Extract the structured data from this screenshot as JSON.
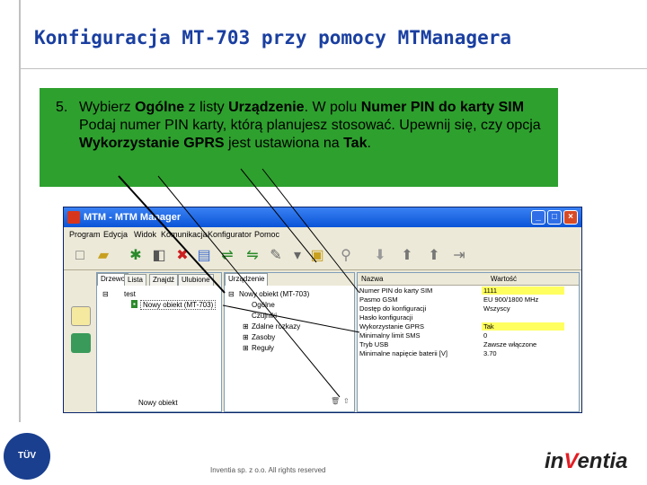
{
  "slide": {
    "title": "Konfiguracja MT-703 przy pomocy MTManagera"
  },
  "callout": {
    "number": "5.",
    "t1": "Wybierz ",
    "b1": "Ogólne",
    "t2": " z listy ",
    "b2": "Urządzenie",
    "t3": ". W polu ",
    "b3": "Numer PIN do karty SIM",
    "t4": " Podaj numer PIN karty, którą planujesz stosować. Upewnij się, czy opcja ",
    "b4": "Wykorzystanie GPRS",
    "t5": " jest ustawiona na ",
    "b5": "Tak",
    "t6": "."
  },
  "app": {
    "window_title": "MTM - MTM Manager",
    "menu": [
      "Program",
      "Edycja",
      "Widok",
      "Komunikacja",
      "Konfigurator",
      "Pomoc"
    ],
    "pane1": {
      "tabs": [
        "Drzewo",
        "Lista",
        "Znajdź",
        "Ulubione"
      ],
      "tree": [
        "test",
        "Nowy obiekt (MT-703)"
      ],
      "status": "Nowy obiekt"
    },
    "pane2": {
      "tab": "Urządzenie",
      "tree": [
        "Nowy obiekt (MT-703)",
        "Ogólne",
        "Czujniki",
        "Zdalne rozkazy",
        "Zasoby",
        "Reguły"
      ]
    },
    "pane3": {
      "col_name": "Nazwa",
      "col_value": "Wartość",
      "rows": [
        {
          "k": "Numer PIN do karty SIM",
          "v": "1111",
          "hl": true
        },
        {
          "k": "Pasmo GSM",
          "v": "EU 900/1800 MHz",
          "hl": false
        },
        {
          "k": "Dostęp do konfiguracji",
          "v": "Wszyscy",
          "hl": false
        },
        {
          "k": "Hasło konfiguracji",
          "v": "",
          "hl": false
        },
        {
          "k": "Wykorzystanie GPRS",
          "v": "Tak",
          "hl": true
        },
        {
          "k": "Minimalny limit SMS",
          "v": "0",
          "hl": false
        },
        {
          "k": "Tryb USB",
          "v": "Zawsze włączone",
          "hl": false
        },
        {
          "k": "Minimalne napięcie baterii [V]",
          "v": "3.70",
          "hl": false
        }
      ]
    }
  },
  "footer": {
    "copyright": "Inventia sp. z o.o. All rights reserved",
    "tuv_label": "TÜV",
    "logo_prefix": "in",
    "logo_accent": "V",
    "logo_suffix": "entia"
  },
  "colors": {
    "title": "#1a3fa0",
    "callout_bg": "#2ea02e",
    "highlight": "#ffff60",
    "logo_accent": "#e31e24"
  }
}
